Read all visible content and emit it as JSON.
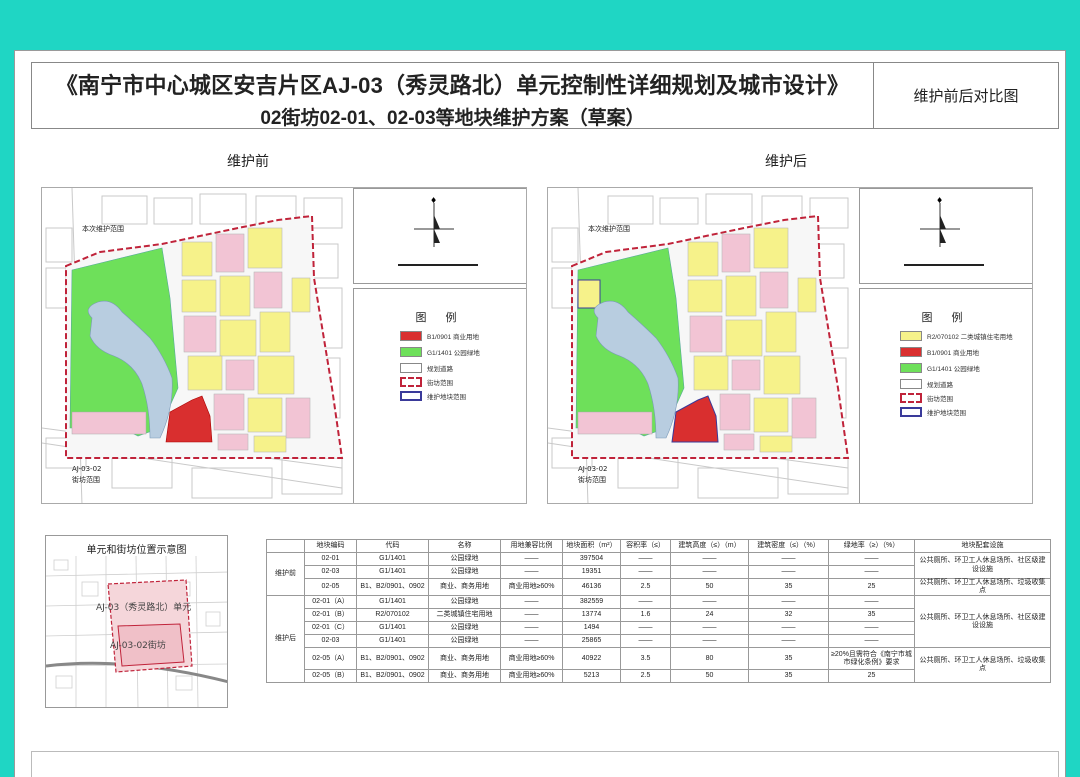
{
  "header": {
    "title_line1": "《南宁市中心城区安吉片区AJ-03（秀灵路北）单元控制性详细规划及城市设计》",
    "title_line2": "02街坊02-01、02-03等地块维护方案（草案）",
    "side_title": "维护前后对比图"
  },
  "colors": {
    "background": "#1fd6c4",
    "park_green": "#6ee05a",
    "commercial_red": "#d92f2f",
    "residential_yellow": "#f6f28a",
    "pink_land": "#f2c4d4",
    "water": "#b8cde0",
    "boundary": "#c0233a"
  },
  "before": {
    "section_label": "维护前",
    "map_labels": {
      "scope": "本次维护范围",
      "block_line1": "AJ-03-02",
      "block_line2": "街坊范围"
    },
    "legend": {
      "title": "图 例",
      "items": [
        {
          "label": "B1/0901 商业用地",
          "color": "#d92f2f"
        },
        {
          "label": "G1/1401 公园绿地",
          "color": "#6ee05a"
        },
        {
          "label": "规划道路",
          "color": "#ffffff"
        },
        {
          "label": "街坊范围",
          "color": "#c0233a"
        },
        {
          "label": "维护地块范围",
          "color": "#3a3a9a"
        }
      ]
    }
  },
  "after": {
    "section_label": "维护后",
    "map_labels": {
      "scope": "本次维护范围",
      "block_line1": "AJ-03-02",
      "block_line2": "街坊范围"
    },
    "legend": {
      "title": "图 例",
      "items": [
        {
          "label": "R2/070102 二类城镇住宅用地",
          "color": "#f6f28a"
        },
        {
          "label": "B1/0901 商业用地",
          "color": "#d92f2f"
        },
        {
          "label": "G1/1401 公园绿地",
          "color": "#6ee05a"
        },
        {
          "label": "规划道路",
          "color": "#ffffff"
        },
        {
          "label": "街坊范围",
          "color": "#c0233a"
        },
        {
          "label": "维护地块范围",
          "color": "#3a3a9a"
        }
      ]
    }
  },
  "location": {
    "title": "单元和街坊位置示意图",
    "unit_label": "AJ-03（秀灵路北）单元",
    "block_label": "AJ-03-02街坊"
  },
  "table": {
    "headers": [
      "",
      "地块编码",
      "代码",
      "名称",
      "用地兼容比例",
      "地块面积（m²）",
      "容积率（≤）",
      "建筑高度（≤）（m）",
      "建筑密度（≤）（%）",
      "绿地率（≥）（%）",
      "地块配套设施"
    ],
    "groups": [
      {
        "name": "维护前",
        "rows": [
          {
            "code": "02-01",
            "type": "G1/1401",
            "name": "公园绿地",
            "compat": "——",
            "area": "397504",
            "far": "——",
            "height": "——",
            "density": "——",
            "green": "——",
            "facility": "公共厕所、环卫工人休息场所、社区级建设设施"
          },
          {
            "code": "02-03",
            "type": "G1/1401",
            "name": "公园绿地",
            "compat": "——",
            "area": "19351",
            "far": "——",
            "height": "——",
            "density": "——",
            "green": "——",
            "facility": ""
          },
          {
            "code": "02-05",
            "type": "B1、B2/0901、0902",
            "name": "商业、商务用地",
            "compat": "商业用地≥60%",
            "area": "46136",
            "far": "2.5",
            "height": "50",
            "density": "35",
            "green": "25",
            "facility": "公共厕所、环卫工人休息场所、垃圾收集点"
          }
        ]
      },
      {
        "name": "维护后",
        "rows": [
          {
            "code": "02-01（A）",
            "type": "G1/1401",
            "name": "公园绿地",
            "compat": "——",
            "area": "382559",
            "far": "——",
            "height": "——",
            "density": "——",
            "green": "——",
            "facility": "公共厕所、环卫工人休息场所、社区级建设设施"
          },
          {
            "code": "02-01（B）",
            "type": "R2/070102",
            "name": "二类城镇住宅用地",
            "compat": "——",
            "area": "13774",
            "far": "1.6",
            "height": "24",
            "density": "32",
            "green": "35",
            "facility": ""
          },
          {
            "code": "02-01（C）",
            "type": "G1/1401",
            "name": "公园绿地",
            "compat": "——",
            "area": "1494",
            "far": "——",
            "height": "——",
            "density": "——",
            "green": "——",
            "facility": ""
          },
          {
            "code": "02-03",
            "type": "G1/1401",
            "name": "公园绿地",
            "compat": "——",
            "area": "25865",
            "far": "——",
            "height": "——",
            "density": "——",
            "green": "——",
            "facility": ""
          },
          {
            "code": "02-05（A）",
            "type": "B1、B2/0901、0902",
            "name": "商业、商务用地",
            "compat": "商业用地≥60%",
            "area": "40922",
            "far": "3.5",
            "height": "80",
            "density": "35",
            "green": "≥20%且需符合《南宁市城市绿化条例》要求",
            "facility": "公共厕所、环卫工人休息场所、垃圾收集点"
          },
          {
            "code": "02-05（B）",
            "type": "B1、B2/0901、0902",
            "name": "商业、商务用地",
            "compat": "商业用地≥60%",
            "area": "5213",
            "far": "2.5",
            "height": "50",
            "density": "35",
            "green": "25",
            "facility": ""
          }
        ]
      }
    ]
  }
}
